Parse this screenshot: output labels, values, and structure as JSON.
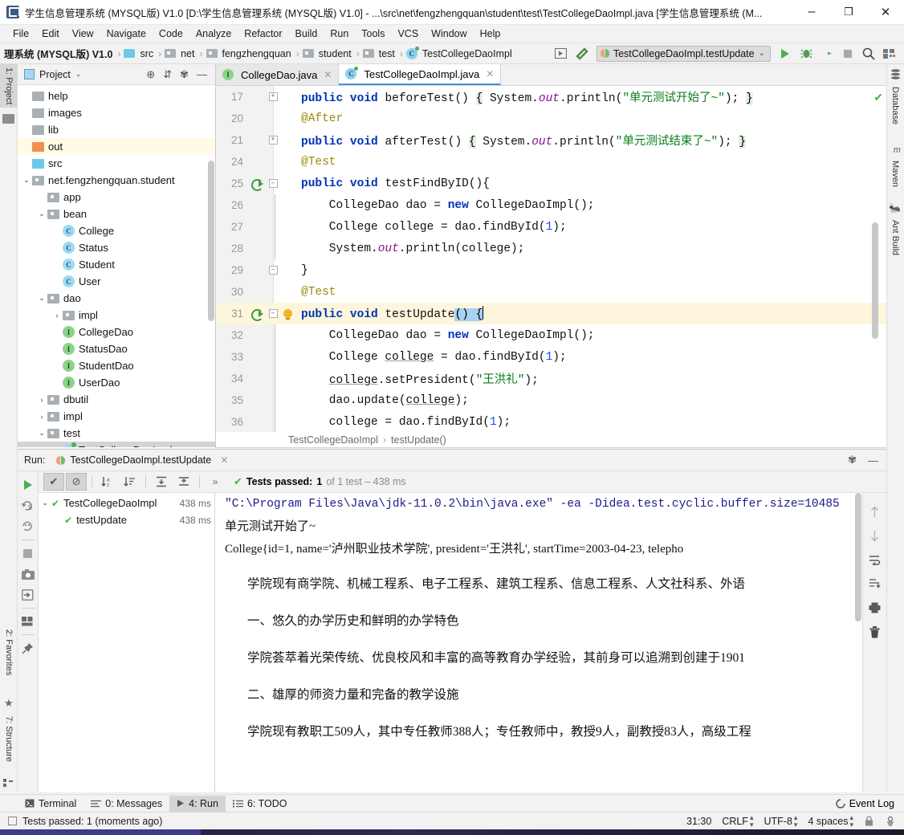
{
  "window": {
    "title": "学生信息管理系统 (MYSQL版) V1.0 [D:\\学生信息管理系统 (MYSQL版) V1.0] - ...\\src\\net\\fengzhengquan\\student\\test\\TestCollegeDaoImpl.java [学生信息管理系统 (M...",
    "minimize": "–",
    "maximize": "❐",
    "close": "✕",
    "app_icon": "intellij-idea-icon"
  },
  "menubar": {
    "items": [
      "File",
      "Edit",
      "View",
      "Navigate",
      "Code",
      "Analyze",
      "Refactor",
      "Build",
      "Run",
      "Tools",
      "VCS",
      "Window",
      "Help"
    ]
  },
  "navbar": {
    "crumbs": [
      {
        "label": "理系统 (MYSQL版) V1.0",
        "icon": "none",
        "bold": true
      },
      {
        "label": "src",
        "icon": "folder-blue"
      },
      {
        "label": "net",
        "icon": "package"
      },
      {
        "label": "fengzhengquan",
        "icon": "package"
      },
      {
        "label": "student",
        "icon": "package"
      },
      {
        "label": "test",
        "icon": "package"
      },
      {
        "label": "TestCollegeDaoImpl",
        "icon": "class-test"
      }
    ],
    "separator": "›",
    "run_config": "TestCollegeDaoImpl.testUpdate",
    "dropdown_caret": "⌄",
    "buttons": [
      {
        "name": "select-in-editor-icon",
        "glyph": "▣"
      },
      {
        "name": "build-hammer-icon",
        "glyph": "⛏"
      },
      {
        "name": "run-button",
        "glyph": "▶"
      },
      {
        "name": "debug-button",
        "glyph": "🐞"
      },
      {
        "name": "run-with-coverage-button",
        "glyph": "◐"
      },
      {
        "name": "stop-button",
        "glyph": "■"
      },
      {
        "name": "search-everywhere-icon",
        "glyph": "🔍"
      },
      {
        "name": "project-structure-icon",
        "glyph": "▤"
      }
    ]
  },
  "left_tool_strip": [
    {
      "label": "1: Project",
      "active": true
    },
    {
      "label": "2: Favorites",
      "icon": "star-icon",
      "active": false
    },
    {
      "label": "7: Structure",
      "icon": "structure-icon",
      "active": false
    }
  ],
  "right_tool_strip": [
    {
      "label": "Database",
      "icon": "database-icon"
    },
    {
      "label": "Maven",
      "icon": "maven-icon"
    },
    {
      "label": "Ant Build",
      "icon": "ant-icon"
    }
  ],
  "project_panel": {
    "title": "Project",
    "caret": "⌄",
    "header_buttons": [
      {
        "name": "locate-icon",
        "glyph": "⊕"
      },
      {
        "name": "collapse-all-icon",
        "glyph": "⇵"
      },
      {
        "name": "settings-gear-icon",
        "glyph": "✾"
      },
      {
        "name": "hide-panel-icon",
        "glyph": "—"
      }
    ],
    "tree": [
      {
        "label": "help",
        "indent": 1,
        "icon": "folder-gray",
        "twist": "",
        "sel": ""
      },
      {
        "label": "images",
        "indent": 1,
        "icon": "folder-gray",
        "twist": "",
        "sel": ""
      },
      {
        "label": "lib",
        "indent": 1,
        "icon": "folder-gray",
        "twist": "",
        "sel": ""
      },
      {
        "label": "out",
        "indent": 1,
        "icon": "folder-orange",
        "twist": "",
        "sel": "out"
      },
      {
        "label": "src",
        "indent": 1,
        "icon": "folder-blue",
        "twist": "",
        "sel": ""
      },
      {
        "label": "net.fengzhengquan.student",
        "indent": 1,
        "icon": "package",
        "twist": "⌄",
        "sel": ""
      },
      {
        "label": "app",
        "indent": 2,
        "icon": "package",
        "twist": "",
        "sel": ""
      },
      {
        "label": "bean",
        "indent": 2,
        "icon": "package",
        "twist": "⌄",
        "sel": ""
      },
      {
        "label": "College",
        "indent": 3,
        "icon": "class",
        "twist": "",
        "sel": ""
      },
      {
        "label": "Status",
        "indent": 3,
        "icon": "class",
        "twist": "",
        "sel": ""
      },
      {
        "label": "Student",
        "indent": 3,
        "icon": "class",
        "twist": "",
        "sel": ""
      },
      {
        "label": "User",
        "indent": 3,
        "icon": "class",
        "twist": "",
        "sel": ""
      },
      {
        "label": "dao",
        "indent": 2,
        "icon": "package",
        "twist": "⌄",
        "sel": ""
      },
      {
        "label": "impl",
        "indent": 3,
        "icon": "package",
        "twist": "›",
        "sel": ""
      },
      {
        "label": "CollegeDao",
        "indent": 3,
        "icon": "interface",
        "twist": "",
        "sel": ""
      },
      {
        "label": "StatusDao",
        "indent": 3,
        "icon": "interface",
        "twist": "",
        "sel": ""
      },
      {
        "label": "StudentDao",
        "indent": 3,
        "icon": "interface",
        "twist": "",
        "sel": ""
      },
      {
        "label": "UserDao",
        "indent": 3,
        "icon": "interface",
        "twist": "",
        "sel": ""
      },
      {
        "label": "dbutil",
        "indent": 2,
        "icon": "package",
        "twist": "›",
        "sel": ""
      },
      {
        "label": "impl",
        "indent": 2,
        "icon": "package",
        "twist": "›",
        "sel": ""
      },
      {
        "label": "test",
        "indent": 2,
        "icon": "package",
        "twist": "⌄",
        "sel": ""
      },
      {
        "label": "TestCollegeDaoImpl",
        "indent": 3,
        "icon": "class-test",
        "twist": "",
        "sel": "gray"
      }
    ]
  },
  "editor": {
    "tabs": [
      {
        "label": "CollegeDao.java",
        "icon": "interface",
        "active": false,
        "close": "✕"
      },
      {
        "label": "TestCollegeDaoImpl.java",
        "icon": "class-test",
        "active": true,
        "close": "✕"
      }
    ],
    "inspection_ok": "✔",
    "lines": [
      {
        "num": "17",
        "runmark": false,
        "fold": "+",
        "bulb": false,
        "hl": false
      },
      {
        "num": "20",
        "runmark": false,
        "fold": "",
        "bulb": false,
        "hl": false
      },
      {
        "num": "21",
        "runmark": false,
        "fold": "+",
        "bulb": false,
        "hl": false
      },
      {
        "num": "24",
        "runmark": false,
        "fold": "",
        "bulb": false,
        "hl": false
      },
      {
        "num": "25",
        "runmark": true,
        "fold": "-",
        "bulb": false,
        "hl": false
      },
      {
        "num": "26",
        "runmark": false,
        "fold": "|",
        "bulb": false,
        "hl": false
      },
      {
        "num": "27",
        "runmark": false,
        "fold": "|",
        "bulb": false,
        "hl": false
      },
      {
        "num": "28",
        "runmark": false,
        "fold": "|",
        "bulb": false,
        "hl": false
      },
      {
        "num": "29",
        "runmark": false,
        "fold": "-",
        "bulb": false,
        "hl": false
      },
      {
        "num": "30",
        "runmark": false,
        "fold": "",
        "bulb": false,
        "hl": false
      },
      {
        "num": "31",
        "runmark": true,
        "fold": "-",
        "bulb": true,
        "hl": true
      },
      {
        "num": "32",
        "runmark": false,
        "fold": "|",
        "bulb": false,
        "hl": false
      },
      {
        "num": "33",
        "runmark": false,
        "fold": "|",
        "bulb": false,
        "hl": false
      },
      {
        "num": "34",
        "runmark": false,
        "fold": "|",
        "bulb": false,
        "hl": false
      },
      {
        "num": "35",
        "runmark": false,
        "fold": "|",
        "bulb": false,
        "hl": false
      },
      {
        "num": "36",
        "runmark": false,
        "fold": "|",
        "bulb": false,
        "hl": false
      }
    ],
    "code_strings": {
      "before_test_msg": "\"单元测试开始了~\"",
      "after_test_msg": "\"单元测试结束了~\"",
      "president_value": "\"王洪礼\""
    },
    "breadcrumb": {
      "class": "TestCollegeDaoImpl",
      "sep": "›",
      "method": "testUpdate()"
    }
  },
  "run_window": {
    "label": "Run:",
    "tab_title": "TestCollegeDaoImpl.testUpdate",
    "tab_close": "✕",
    "header_buttons": [
      {
        "name": "settings-gear-icon",
        "glyph": "✾"
      },
      {
        "name": "hide-window-icon",
        "glyph": "—"
      }
    ],
    "sidebar_buttons": [
      {
        "name": "rerun-button",
        "glyph": "▶"
      },
      {
        "name": "rerun-failed-tests-button",
        "glyph": "↻9"
      },
      {
        "name": "toggle-auto-test-button",
        "glyph": "⟳"
      },
      {
        "name": "stop-button",
        "glyph": "■"
      },
      {
        "name": "export-snapshot-button",
        "glyph": "📷"
      },
      {
        "name": "import-tests-button",
        "glyph": "⇥"
      },
      {
        "name": "layout-settings-button",
        "glyph": "▥"
      },
      {
        "name": "pin-tab-button",
        "glyph": "📌"
      }
    ],
    "toolbar_buttons": [
      {
        "name": "show-passed-toggle",
        "glyph": "✔",
        "pressed": true
      },
      {
        "name": "show-ignored-toggle",
        "glyph": "⊘",
        "pressed": true
      },
      {
        "name": "sort-alphabetically-button",
        "glyph": "↓a\\nz"
      },
      {
        "name": "sort-by-duration-button",
        "glyph": "↓≡"
      },
      {
        "name": "expand-all-button",
        "glyph": "⤒"
      },
      {
        "name": "collapse-all-button",
        "glyph": "⤓"
      },
      {
        "name": "more-button",
        "glyph": "»"
      }
    ],
    "status": {
      "check": "✔",
      "passed_label": "Tests passed:",
      "passed_count": "1",
      "of_text": "of 1 test – 438 ms"
    },
    "test_tree": [
      {
        "twist": "⌄",
        "check": "✔",
        "name": "TestCollegeDaoImpl",
        "ms": "438 ms",
        "indent": 0
      },
      {
        "twist": "",
        "check": "✔",
        "name": "testUpdate",
        "ms": "438 ms",
        "indent": 1
      }
    ],
    "console_lines": [
      {
        "cls": "cmd",
        "text": "\"C:\\Program Files\\Java\\jdk-11.0.2\\bin\\java.exe\" -ea -Didea.test.cyclic.buffer.size=10485"
      },
      {
        "cls": "zh",
        "text": "单元测试开始了~"
      },
      {
        "cls": "zh",
        "text": "College{id=1, name='泸州职业技术学院', president='王洪礼', startTime=2003-04-23, telepho"
      },
      {
        "cls": "gap",
        "text": ""
      },
      {
        "cls": "big",
        "text": "学院现有商学院、机械工程系、电子工程系、建筑工程系、信息工程系、人文社科系、外语"
      },
      {
        "cls": "gap",
        "text": ""
      },
      {
        "cls": "big",
        "text": "一、悠久的办学历史和鲜明的办学特色"
      },
      {
        "cls": "gap",
        "text": ""
      },
      {
        "cls": "big",
        "text": "学院荟萃着光荣传统、优良校风和丰富的高等教育办学经验，其前身可以追溯到创建于1901"
      },
      {
        "cls": "gap",
        "text": ""
      },
      {
        "cls": "big",
        "text": "二、雄厚的师资力量和完备的教学设施"
      },
      {
        "cls": "gap",
        "text": ""
      },
      {
        "cls": "big",
        "text": "学院现有教职工509人，其中专任教师388人；专任教师中，教授9人，副教授83人，高级工程"
      }
    ],
    "console_side_buttons": [
      {
        "name": "scroll-up-icon",
        "glyph": "↑"
      },
      {
        "name": "scroll-down-icon",
        "glyph": "↓"
      },
      {
        "name": "soft-wrap-icon",
        "glyph": "⇥"
      },
      {
        "name": "scroll-to-end-icon",
        "glyph": "⇟"
      },
      {
        "name": "print-icon",
        "glyph": "🖨"
      },
      {
        "name": "clear-all-icon",
        "glyph": "🗑"
      }
    ]
  },
  "bottom_strip": {
    "tabs": [
      {
        "label": "Terminal",
        "icon": "terminal-icon",
        "active": false
      },
      {
        "label": "0: Messages",
        "icon": "messages-icon",
        "active": false
      },
      {
        "label": "4: Run",
        "icon": "run-icon",
        "active": true
      },
      {
        "label": "6: TODO",
        "icon": "todo-icon",
        "active": false
      }
    ],
    "event_log": {
      "label": "Event Log",
      "icon": "event-log-icon"
    }
  },
  "statusbar": {
    "message": "Tests passed: 1 (moments ago)",
    "caret_position": "31:30",
    "line_separator": "CRLF",
    "encoding": "UTF-8",
    "indent": "4 spaces",
    "lock_icon": "lock-icon",
    "inspection_icon": "inspection-icon",
    "stepper": "⇅"
  },
  "colors": {
    "accent_blue": "#4a90d9",
    "green": "#4caf50",
    "keyword": "#0033b3",
    "string": "#067d17",
    "annotation": "#9e880d",
    "number": "#1750eb",
    "static_field": "#871094",
    "highlight_row": "#fdf6dd",
    "selection": "#a6d2f4"
  }
}
